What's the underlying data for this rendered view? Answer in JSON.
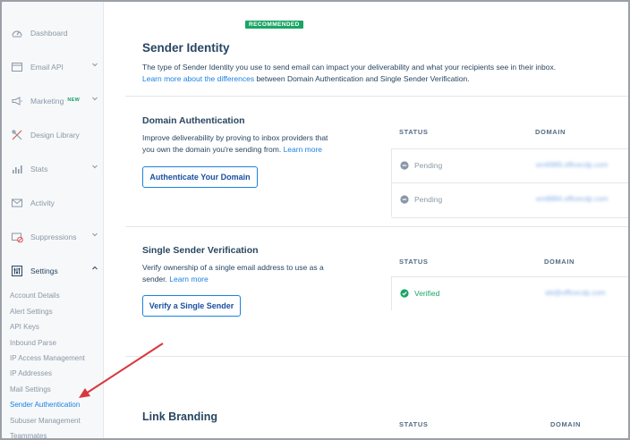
{
  "sidebar": {
    "items": [
      {
        "label": "Dashboard",
        "icon": "dashboard-icon",
        "has_chevron": false
      },
      {
        "label": "Email API",
        "icon": "email-api-icon",
        "has_chevron": true
      },
      {
        "label": "Marketing",
        "icon": "megaphone-icon",
        "has_chevron": true,
        "badge": "NEW"
      },
      {
        "label": "Design Library",
        "icon": "design-library-icon",
        "has_chevron": false
      },
      {
        "label": "Stats",
        "icon": "stats-icon",
        "has_chevron": true
      },
      {
        "label": "Activity",
        "icon": "activity-icon",
        "has_chevron": false
      },
      {
        "label": "Suppressions",
        "icon": "suppressions-icon",
        "has_chevron": true
      },
      {
        "label": "Settings",
        "icon": "settings-icon",
        "has_chevron": true
      }
    ],
    "settings_subitems": [
      "Account Details",
      "Alert Settings",
      "API Keys",
      "Inbound Parse",
      "IP Access Management",
      "IP Addresses",
      "Mail Settings",
      "Sender Authentication",
      "Subuser Management",
      "Teammates"
    ],
    "active_subitem": "Sender Authentication"
  },
  "main": {
    "recommended_badge": "RECOMMENDED",
    "sender_identity": {
      "title": "Sender Identity",
      "description": "The type of Sender Identity you use to send email can impact your deliverability and what your recipients see in their inbox.",
      "link_text": "Learn more about the differences",
      "link_suffix": " between Domain Authentication and Single Sender Verification."
    },
    "domain_auth": {
      "title": "Domain Authentication",
      "description_line1": "Improve deliverability by proving to inbox providers that",
      "description_line2": "you own the domain you're sending from.",
      "learn_more": "Learn more",
      "button": "Authenticate Your Domain",
      "table": {
        "headers": [
          "STATUS",
          "DOMAIN"
        ],
        "rows": [
          {
            "status": "Pending",
            "domain": "em6989.officecdp.com"
          },
          {
            "status": "Pending",
            "domain": "em8884.officecdp.com"
          }
        ]
      }
    },
    "single_sender": {
      "title": "Single Sender Verification",
      "description_line1": "Verify ownership of a single email address to use as a",
      "description_line2": "sender.",
      "learn_more": "Learn more",
      "button": "Verify a Single Sender",
      "table": {
        "headers": [
          "STATUS",
          "DOMAIN"
        ],
        "rows": [
          {
            "status": "Verified",
            "domain": "sbi@officecdp.com"
          }
        ]
      }
    },
    "link_branding": {
      "title": "Link Branding",
      "table_headers": [
        "STATUS",
        "DOMAIN"
      ]
    }
  },
  "colors": {
    "accent": "#1a82e2",
    "success": "#1aa565",
    "annotation_arrow": "#d9363e"
  }
}
